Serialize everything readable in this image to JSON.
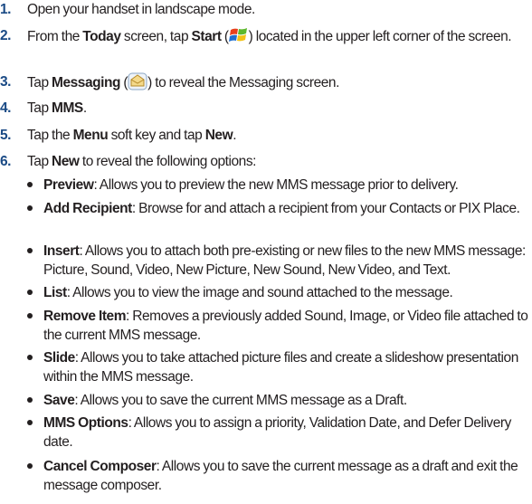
{
  "steps": [
    {
      "num": "1.",
      "parts": [
        {
          "t": "Open your handset in landscape mode."
        }
      ]
    },
    {
      "num": "2.",
      "parts": [
        {
          "t": "From the "
        },
        {
          "b": "Today"
        },
        {
          "t": " screen, tap "
        },
        {
          "b": "Start"
        },
        {
          "t": " ("
        },
        {
          "icon": "windows-start-icon"
        },
        {
          "t": ") located in the upper left corner of the screen."
        }
      ]
    },
    {
      "num": "3.",
      "parts": [
        {
          "t": "Tap "
        },
        {
          "b": "Messaging"
        },
        {
          "t": " ("
        },
        {
          "icon": "messaging-envelope-icon"
        },
        {
          "t": ") to reveal the Messaging screen."
        }
      ]
    },
    {
      "num": "4.",
      "parts": [
        {
          "t": "Tap "
        },
        {
          "b": "MMS"
        },
        {
          "t": "."
        }
      ]
    },
    {
      "num": "5.",
      "parts": [
        {
          "t": "Tap the "
        },
        {
          "b": "Menu"
        },
        {
          "t": " soft key and tap "
        },
        {
          "b": "New"
        },
        {
          "t": "."
        }
      ]
    },
    {
      "num": "6.",
      "parts": [
        {
          "t": "Tap "
        },
        {
          "b": "New"
        },
        {
          "t": " to reveal the following options:"
        }
      ]
    }
  ],
  "options": [
    {
      "term": "Preview",
      "desc": ": Allows you to preview the new MMS message prior to delivery."
    },
    {
      "term": "Add Recipient",
      "desc": ": Browse for and attach a recipient from your Contacts or PIX Place."
    },
    {
      "term": "Insert",
      "desc": ": Allows you to attach both pre-existing or new files to the new MMS message: Picture, Sound, Video, New Picture, New Sound, New Video, and Text."
    },
    {
      "term": "List",
      "desc": ": Allows you to view the image and sound attached to the message."
    },
    {
      "term": "Remove Item",
      "desc": ": Removes a previously added Sound, Image, or Video file attached to the current MMS message."
    },
    {
      "term": "Slide",
      "desc": ": Allows you to take attached picture files and create a slideshow presentation within the MMS message."
    },
    {
      "term": "Save",
      "desc": ": Allows you to save the current MMS message as a Draft."
    },
    {
      "term": "MMS Options",
      "desc": ": Allows you to assign a priority, Validation Date, and Defer Delivery date."
    },
    {
      "term": "Cancel Composer",
      "desc": ": Allows you to save the current message as a draft and exit the message composer."
    }
  ]
}
